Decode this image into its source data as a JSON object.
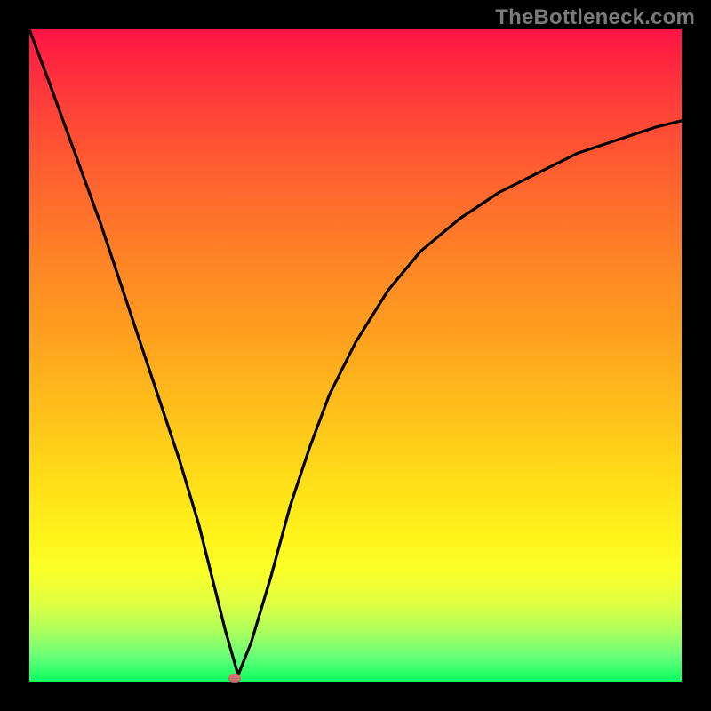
{
  "watermark": "TheBottleneck.com",
  "chart_data": {
    "type": "line",
    "title": "",
    "xlabel": "",
    "ylabel": "",
    "xlim": [
      0,
      100
    ],
    "ylim": [
      0,
      100
    ],
    "series": [
      {
        "name": "bottleneck-curve",
        "x": [
          0,
          3,
          7,
          11,
          15,
          19,
          23,
          26,
          28,
          30,
          32,
          34,
          37,
          40,
          43,
          46,
          50,
          55,
          60,
          66,
          72,
          78,
          84,
          90,
          96,
          100
        ],
        "y": [
          100,
          92,
          81,
          70,
          58,
          46,
          34,
          24,
          16,
          8,
          1,
          6,
          16,
          27,
          36,
          44,
          52,
          60,
          66,
          71,
          75,
          78,
          81,
          83,
          85,
          86
        ]
      }
    ],
    "marker": {
      "x": 31.5,
      "y": 0.5
    },
    "gradient_stops": [
      {
        "pct": 0,
        "color": "#ff1444"
      },
      {
        "pct": 50,
        "color": "#ffc41a"
      },
      {
        "pct": 85,
        "color": "#faff28"
      },
      {
        "pct": 100,
        "color": "#0cff60"
      }
    ]
  }
}
